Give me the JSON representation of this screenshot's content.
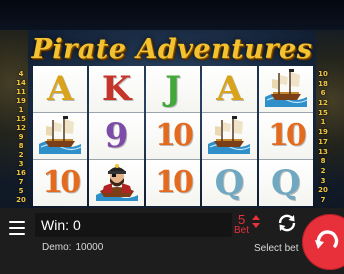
{
  "game": {
    "title": "Pirate Adventures",
    "colors": {
      "accent": "#e8303a",
      "title_gold": "#f2c230",
      "bar_bg": "#1d1d1d"
    }
  },
  "paylines": {
    "left": [
      "4",
      "14",
      "11",
      "19",
      "1",
      "15",
      "12",
      "9",
      "8",
      "2",
      "3",
      "16",
      "7",
      "5",
      "20"
    ],
    "right": [
      "10",
      "18",
      "6",
      "12",
      "15",
      "1",
      "19",
      "17",
      "13",
      "8",
      "2",
      "3",
      "20",
      "7"
    ]
  },
  "reels": [
    [
      {
        "kind": "letter",
        "text": "A",
        "color": "#d9a41c"
      },
      {
        "kind": "icon",
        "icon": "pirate-ship-icon"
      },
      {
        "kind": "letter",
        "text": "10",
        "color": "#e46a1e"
      }
    ],
    [
      {
        "kind": "letter",
        "text": "K",
        "color": "#c7342a"
      },
      {
        "kind": "letter",
        "text": "9",
        "color": "#7d4ba8"
      },
      {
        "kind": "icon",
        "icon": "pirate-captain-icon"
      }
    ],
    [
      {
        "kind": "letter",
        "text": "J",
        "color": "#43a83a"
      },
      {
        "kind": "letter",
        "text": "10",
        "color": "#e46a1e"
      },
      {
        "kind": "letter",
        "text": "10",
        "color": "#e46a1e"
      }
    ],
    [
      {
        "kind": "letter",
        "text": "A",
        "color": "#d9a41c"
      },
      {
        "kind": "icon",
        "icon": "pirate-ship-icon"
      },
      {
        "kind": "letter",
        "text": "Q",
        "color": "#6fa8c0"
      }
    ],
    [
      {
        "kind": "icon",
        "icon": "pirate-ship-icon"
      },
      {
        "kind": "letter",
        "text": "10",
        "color": "#e46a1e"
      },
      {
        "kind": "letter",
        "text": "Q",
        "color": "#6fa8c0"
      }
    ]
  ],
  "bottom_bar": {
    "menu_icon": "hamburger-menu-icon",
    "win_label": "Win:",
    "win_value": "0",
    "demo_label": "Demo:",
    "demo_value": "10000",
    "bet_value": "5",
    "bet_label": "Bet",
    "refresh_icon": "refresh-arrows-icon",
    "select_bet_label": "Select bet",
    "spin_icon": "spin-arrow-icon"
  }
}
